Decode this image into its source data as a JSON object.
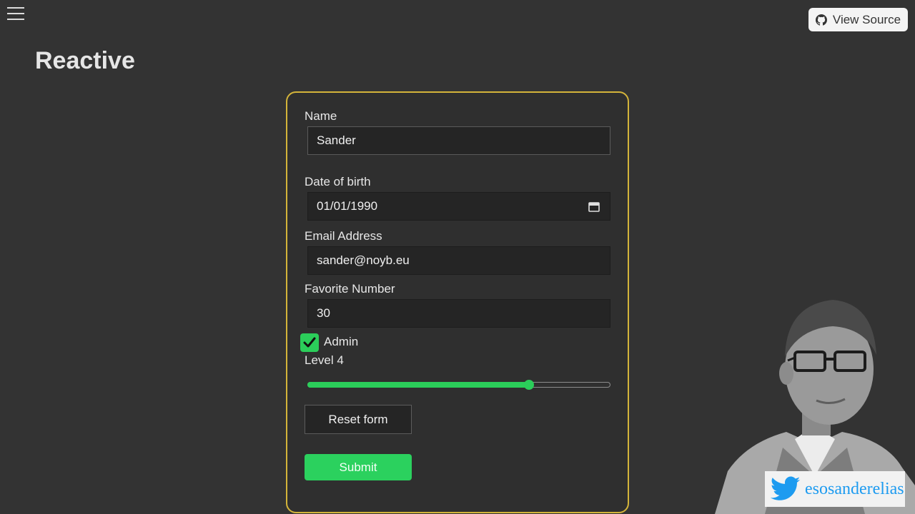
{
  "header": {
    "title": "Reactive",
    "source_button_label": "View Source"
  },
  "form": {
    "name": {
      "label": "Name",
      "value": "Sander"
    },
    "dob": {
      "label": "Date of birth",
      "value": "01/01/1990"
    },
    "email": {
      "label": "Email Address",
      "value": "sander@noyb.eu"
    },
    "favorite": {
      "label": "Favorite Number",
      "value": "30"
    },
    "admin": {
      "label": "Admin",
      "checked": true
    },
    "level": {
      "label": "Level 4",
      "value": 4,
      "min": 0,
      "max": 5.7,
      "fraction": 0.73
    },
    "reset_label": "Reset form",
    "submit_label": "Submit"
  },
  "badge": {
    "handle": "esosanderelias",
    "icon": "twitter-bird-icon"
  },
  "colors": {
    "background": "#333333",
    "card_border": "#d4b43a",
    "accent_green": "#2bd15e",
    "twitter_blue": "#1d9bf0"
  }
}
